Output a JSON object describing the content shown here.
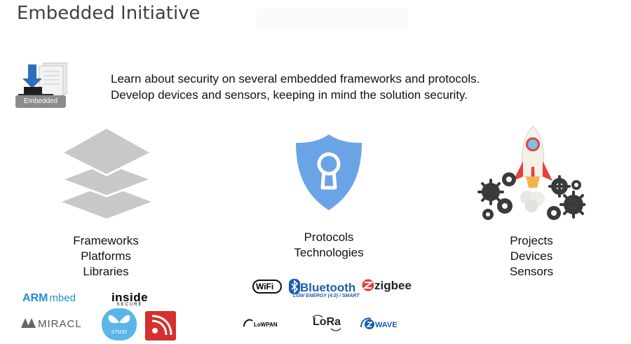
{
  "title": "Embedded Initiative",
  "embedded_badge": "Embedded",
  "intro": {
    "line1": "Learn about security on several embedded frameworks and protocols.",
    "line2": "Develop devices and sensors, keeping in mind the solution security."
  },
  "columns": {
    "left": [
      "Frameworks",
      "Platforms",
      "Libraries"
    ],
    "middle": [
      "Protocols",
      "Technologies"
    ],
    "right": [
      "Projects",
      "Devices",
      "Sensors"
    ]
  },
  "logos": {
    "arm": "ARM",
    "mbed": "mbed",
    "inside": "inside",
    "secure": "SECURE",
    "miracl": "MIRACL",
    "stm32": "STM32",
    "wifi": "WiFi",
    "bluetooth": "Bluetooth",
    "bluetooth_sub": "LOW ENERGY (4.0) / SMART",
    "zigbee": "zigbee",
    "lowpan": "LoWPAN",
    "lora": "LoRa",
    "zwave": "WAVE"
  },
  "colors": {
    "shield": "#6ba4e6",
    "layers": "#c8c8c8",
    "arm_blue": "#1f8fd0",
    "esp_red": "#d3302f",
    "rocket_red": "#e5413d"
  }
}
